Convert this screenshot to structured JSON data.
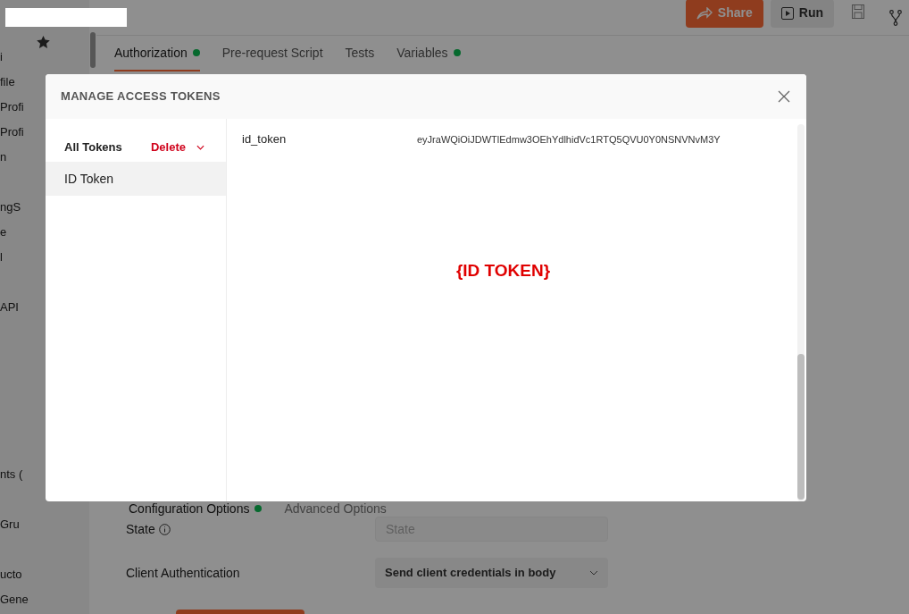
{
  "sidebar": {
    "groups": [
      [
        "i",
        "file",
        "Profi",
        "Profi",
        "n"
      ],
      [
        "ngS",
        "e",
        "l"
      ],
      [
        "API"
      ],
      [
        "nts ("
      ],
      [
        "Gru"
      ],
      [
        "ucto",
        "Gene"
      ]
    ]
  },
  "toolbar": {
    "share": "Share",
    "run": "Run"
  },
  "tabs": [
    {
      "label": "Authorization",
      "indicator": true,
      "selected": true
    },
    {
      "label": "Pre-request Script",
      "indicator": false,
      "selected": false
    },
    {
      "label": "Tests",
      "indicator": false,
      "selected": false
    },
    {
      "label": "Variables",
      "indicator": true,
      "selected": false
    }
  ],
  "config_tabs": [
    {
      "label": "Configuration Options",
      "indicator": true,
      "selected": true
    },
    {
      "label": "Advanced Options",
      "indicator": false,
      "selected": false
    }
  ],
  "form": {
    "state": {
      "label": "State",
      "placeholder": "State"
    },
    "client_authentication": {
      "label": "Client Authentication",
      "value": "Send client credentials in body"
    }
  },
  "modal": {
    "title": "MANAGE ACCESS TOKENS",
    "all_tokens": "All Tokens",
    "delete": "Delete",
    "tokens": [
      {
        "name": "ID Token",
        "selected": true
      }
    ],
    "detail": {
      "key": "id_token",
      "value": "eyJraWQiOiJDWTlEdmw3OEhYdlhidVc1RTQ5QVU0Y0NSNVNvM3Y"
    },
    "annotation": "{ID TOKEN}"
  }
}
